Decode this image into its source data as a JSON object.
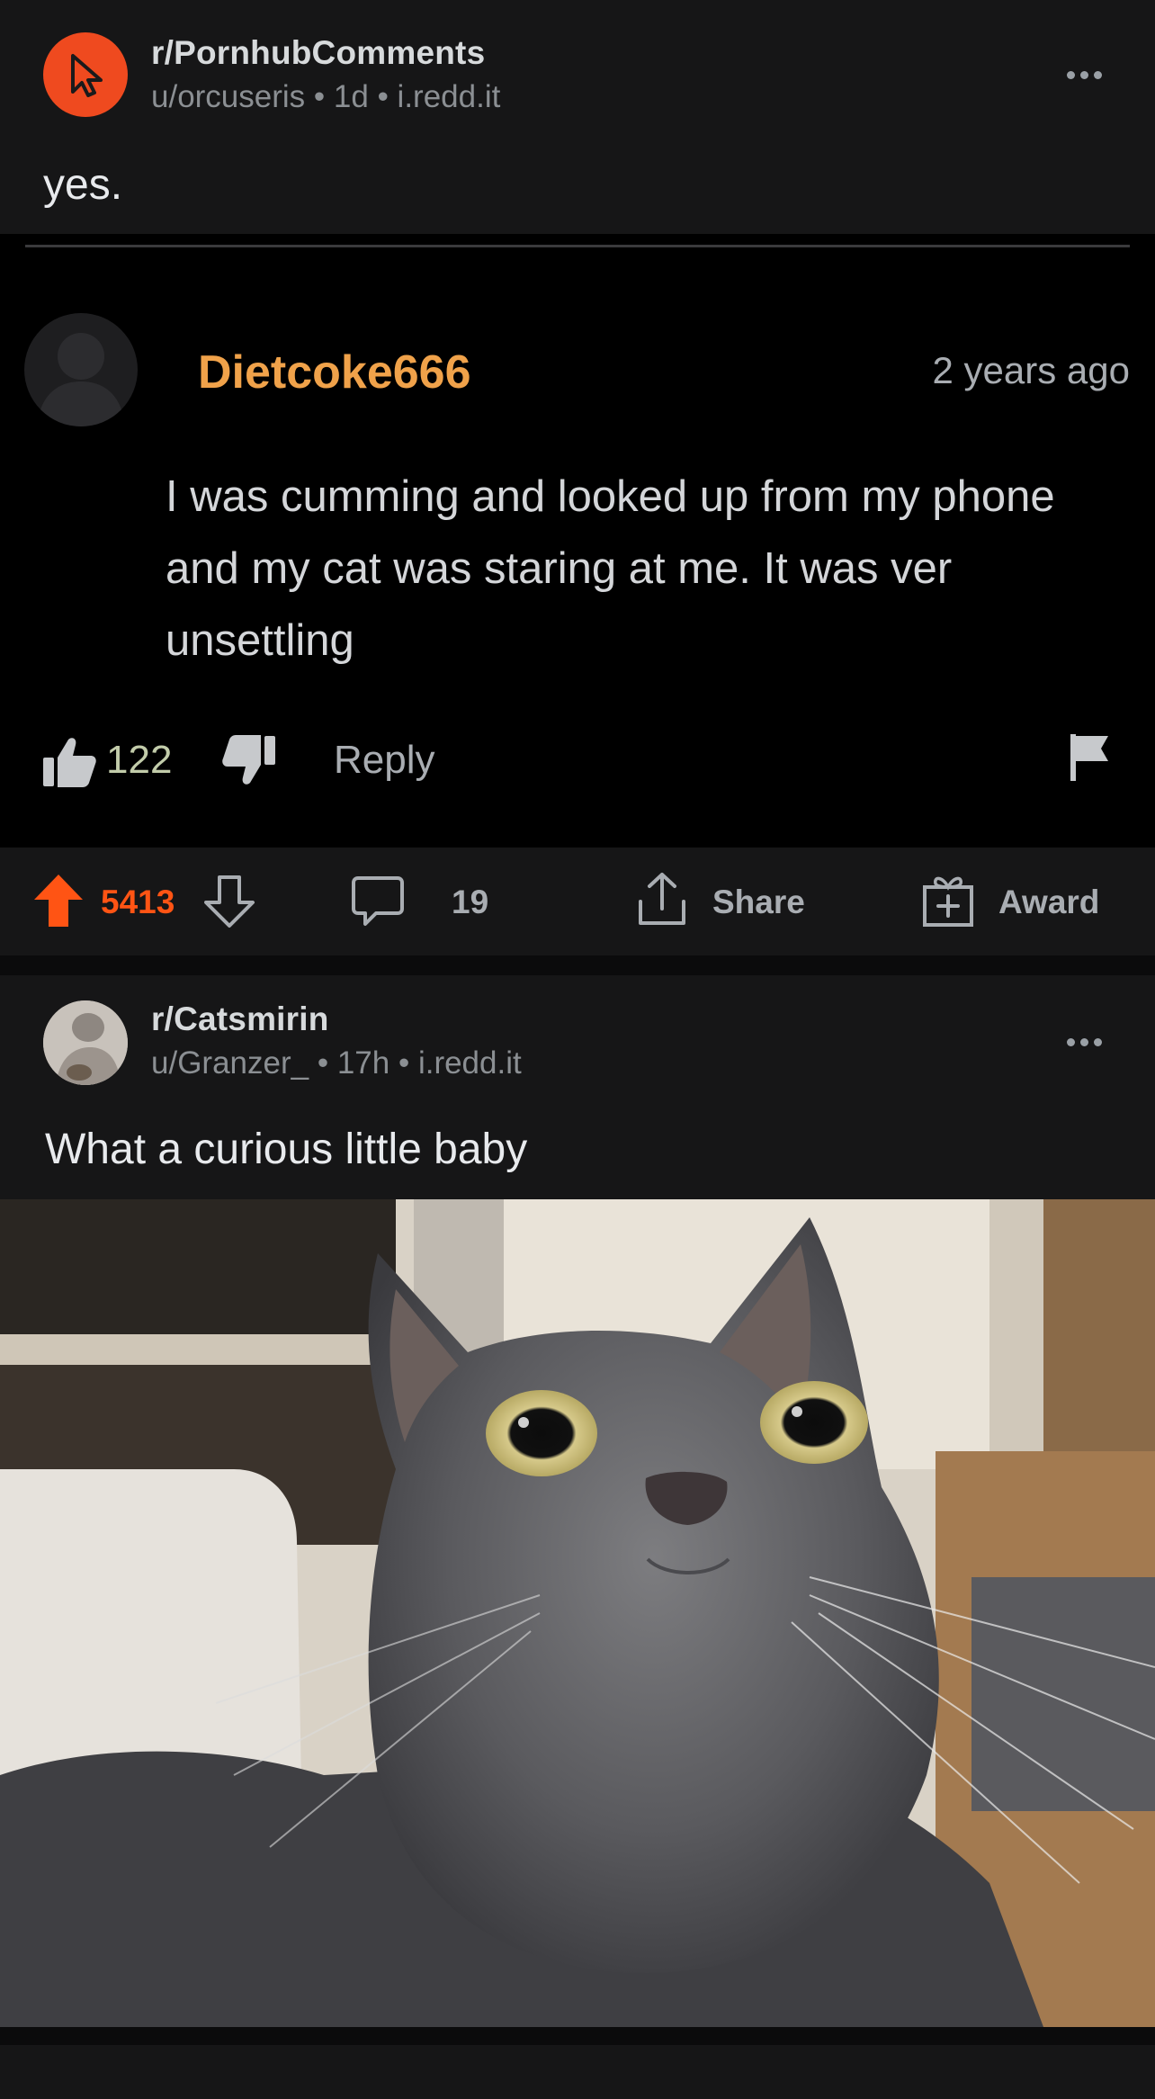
{
  "post1": {
    "subreddit": "r/PornhubComments",
    "user": "u/orcuseris",
    "age": "1d",
    "domain": "i.redd.it",
    "title": "yes.",
    "embedded_comment": {
      "username": "Dietcoke666",
      "time": "2 years ago",
      "body": "I was cumming and looked up from my phone and my cat was staring at me. It was ver unsettling",
      "likes": "122",
      "reply_label": "Reply"
    },
    "score": "5413",
    "comments": "19",
    "share_label": "Share",
    "award_label": "Award"
  },
  "post2": {
    "subreddit": "r/Catsmirin",
    "user": "u/Granzer_",
    "age": "17h",
    "domain": "i.redd.it",
    "title": "What a curious little baby"
  },
  "colors": {
    "upvote": "#ff5414",
    "username_orange": "#f0a24a",
    "background": "#161617"
  }
}
